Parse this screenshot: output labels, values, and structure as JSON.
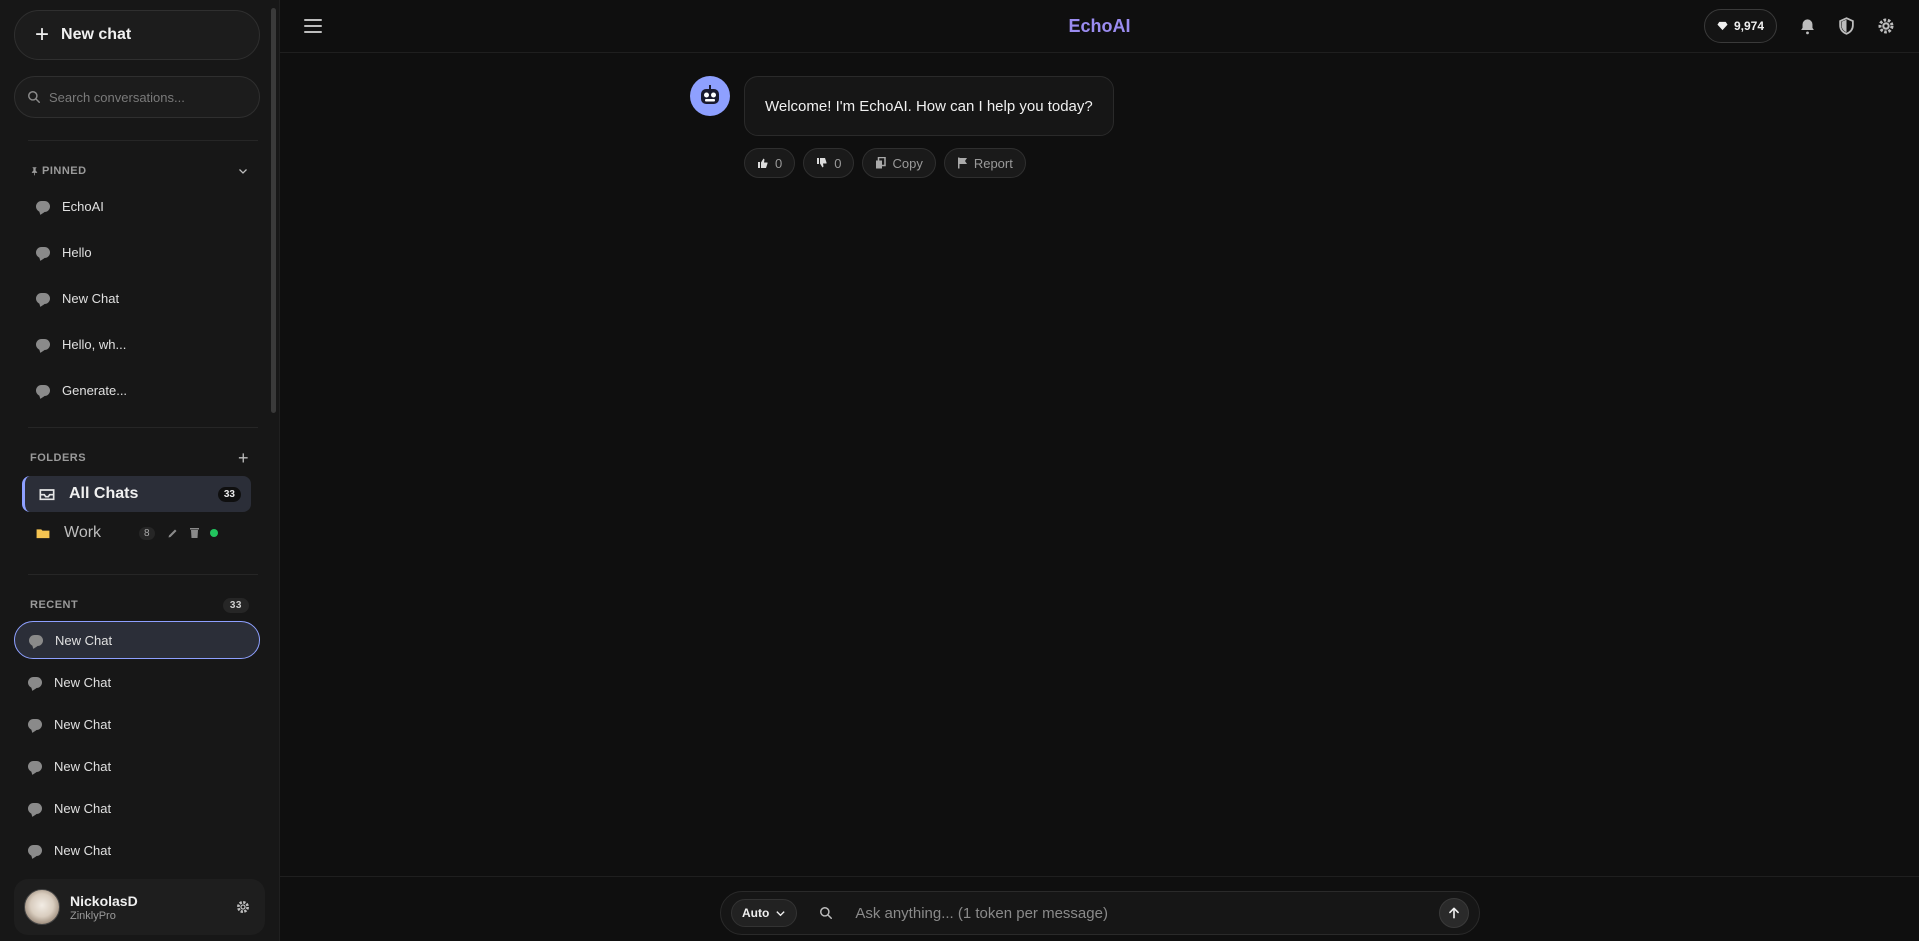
{
  "sidebar": {
    "new_chat_label": "New chat",
    "search_placeholder": "Search conversations...",
    "pinned": {
      "heading": "PINNED",
      "items": [
        {
          "label": "EchoAI"
        },
        {
          "label": "Hello"
        },
        {
          "label": "New Chat"
        },
        {
          "label": "Hello, wh..."
        },
        {
          "label": "Generate..."
        }
      ]
    },
    "folders": {
      "heading": "FOLDERS",
      "all_chats": {
        "label": "All Chats",
        "count": "33"
      },
      "work": {
        "label": "Work",
        "count": "8"
      }
    },
    "recent": {
      "heading": "RECENT",
      "count": "33",
      "items": [
        {
          "label": "New Chat",
          "active": true
        },
        {
          "label": "New Chat"
        },
        {
          "label": "New Chat"
        },
        {
          "label": "New Chat"
        },
        {
          "label": "New Chat"
        },
        {
          "label": "New Chat"
        }
      ]
    },
    "user": {
      "name": "NickolasD",
      "plan": "ZinklyPro"
    }
  },
  "header": {
    "title": "EchoAI",
    "tokens": "9,974"
  },
  "chat": {
    "welcome_message": "Welcome! I'm EchoAI. How can I help you today?",
    "actions": {
      "like_count": "0",
      "dislike_count": "0",
      "copy_label": "Copy",
      "report_label": "Report"
    }
  },
  "composer": {
    "model": "Auto",
    "placeholder": "Ask anything... (1 token per message)"
  },
  "colors": {
    "accent": "#8ea0ff",
    "title": "#9b8cf0",
    "background": "#0f0f0f",
    "sidebar": "#171717",
    "online": "#22c55e",
    "folder": "#f5c451"
  }
}
